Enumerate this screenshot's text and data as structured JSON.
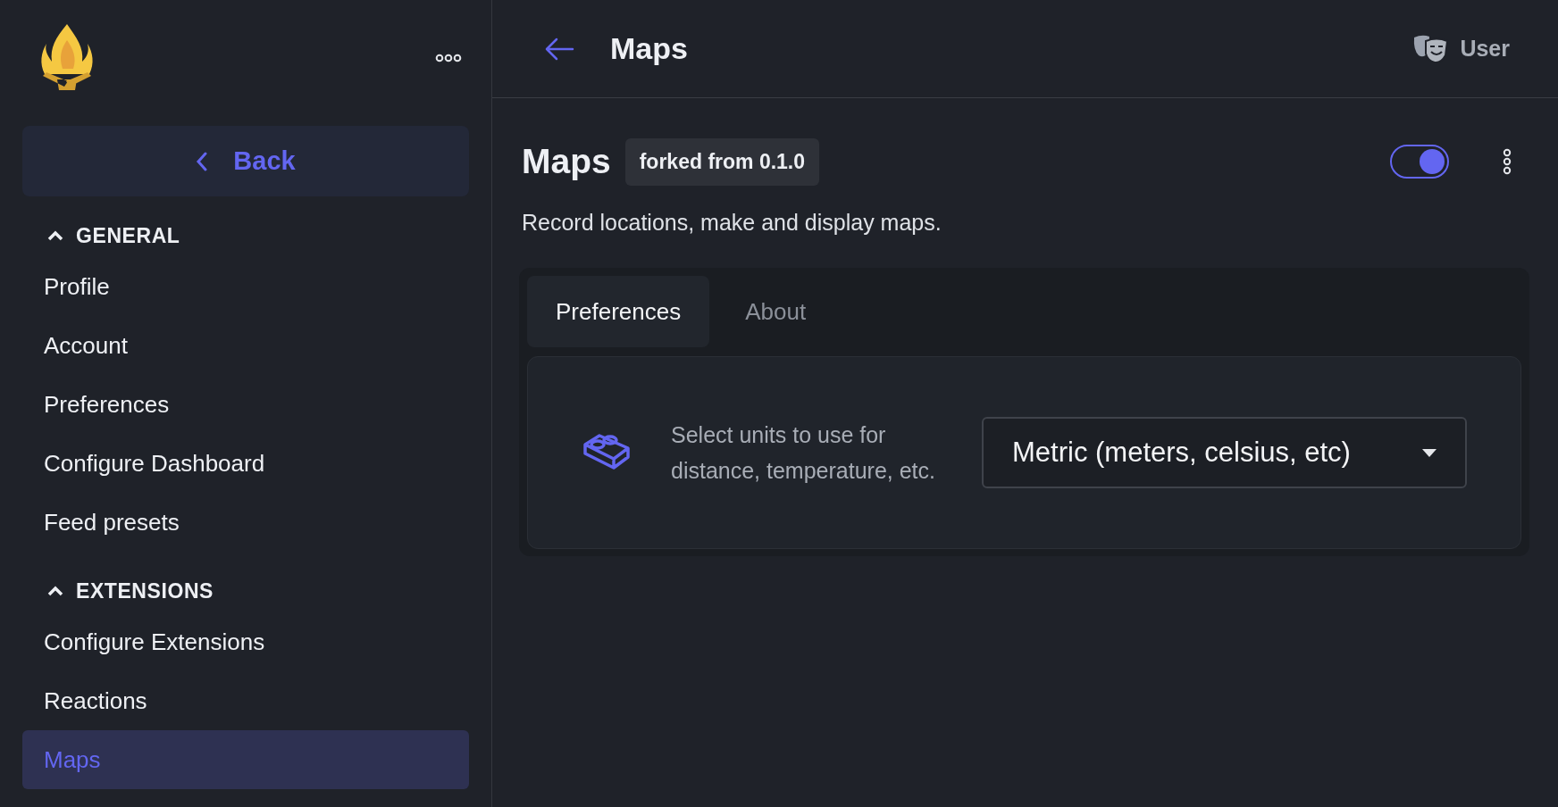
{
  "sidebar": {
    "back_label": "Back",
    "sections": [
      {
        "title": "GENERAL",
        "expanded": true,
        "items": [
          {
            "label": "Profile",
            "selected": false
          },
          {
            "label": "Account",
            "selected": false
          },
          {
            "label": "Preferences",
            "selected": false
          },
          {
            "label": "Configure Dashboard",
            "selected": false
          },
          {
            "label": "Feed presets",
            "selected": false
          }
        ]
      },
      {
        "title": "EXTENSIONS",
        "expanded": true,
        "items": [
          {
            "label": "Configure Extensions",
            "selected": false
          },
          {
            "label": "Reactions",
            "selected": false
          },
          {
            "label": "Maps",
            "selected": true
          }
        ]
      }
    ]
  },
  "header": {
    "title": "Maps",
    "user_label": "User"
  },
  "extension": {
    "name": "Maps",
    "badge": "forked from 0.1.0",
    "enabled": true,
    "description": "Record locations, make and display maps.",
    "tabs": [
      {
        "label": "Preferences",
        "selected": true
      },
      {
        "label": "About",
        "selected": false
      }
    ],
    "setting": {
      "description": "Select units to use for distance, temperature, etc.",
      "value": "Metric (meters, celsius, etc)"
    }
  }
}
